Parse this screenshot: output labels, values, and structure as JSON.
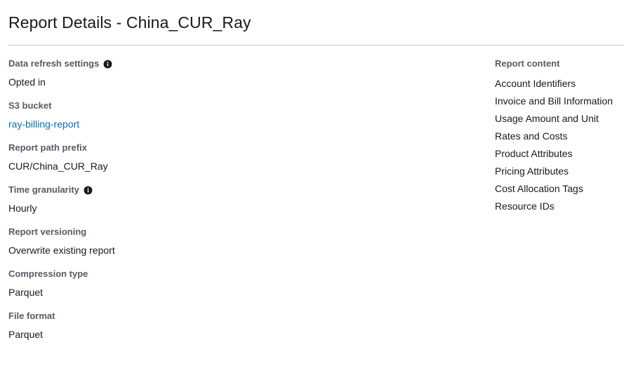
{
  "header": {
    "title": "Report Details - China_CUR_Ray",
    "divider": true
  },
  "colors": {
    "text": "#16191f",
    "label": "#545b64",
    "link": "#0a6eb4",
    "divider": "#c5c5c5",
    "background": "#ffffff",
    "info_icon": "#16191f"
  },
  "details": {
    "fields": [
      {
        "label": "Data refresh settings",
        "value": "Opted in",
        "info_icon": "info-icon",
        "has_info": true,
        "is_link": false
      },
      {
        "label": "S3 bucket",
        "value": "ray-billing-report",
        "has_info": false,
        "is_link": true
      },
      {
        "label": "Report path prefix",
        "value": "CUR/China_CUR_Ray",
        "has_info": false,
        "is_link": false
      },
      {
        "label": "Time granularity",
        "value": "Hourly",
        "info_icon": "info-icon",
        "has_info": true,
        "is_link": false
      },
      {
        "label": "Report versioning",
        "value": "Overwrite existing report",
        "has_info": false,
        "is_link": false
      },
      {
        "label": "Compression type",
        "value": "Parquet",
        "has_info": false,
        "is_link": false
      },
      {
        "label": "File format",
        "value": "Parquet",
        "has_info": false,
        "is_link": false
      }
    ]
  },
  "report_content": {
    "heading": "Report content",
    "items": [
      "Account Identifiers",
      "Invoice and Bill Information",
      "Usage Amount and Unit",
      "Rates and Costs",
      "Product Attributes",
      "Pricing Attributes",
      "Cost Allocation Tags",
      "Resource IDs"
    ]
  }
}
